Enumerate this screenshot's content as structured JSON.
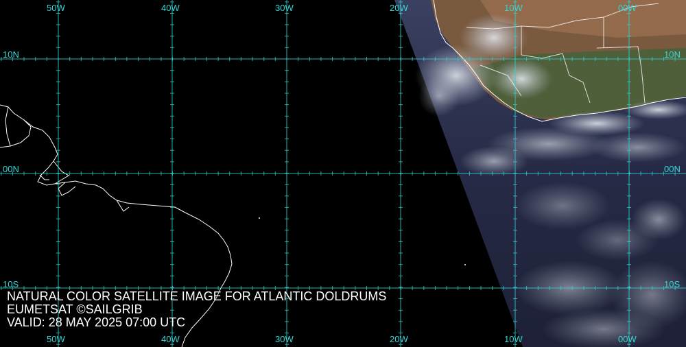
{
  "map": {
    "lon_labels": [
      "50W",
      "40W",
      "30W",
      "20W",
      "10W",
      "00W"
    ],
    "lat_labels": [
      "10N",
      "00N",
      "10S"
    ]
  },
  "caption": {
    "line1": "NATURAL COLOR SATELLITE IMAGE FOR ATLANTIC DOLDRUMS",
    "line2": "EUMETSAT ©SAILGRIB",
    "line3": "VALID:  28 MAY 2025 07:00 UTC"
  },
  "colors": {
    "grid": "#2fd0d0",
    "ocean_dark": "#000000",
    "ocean_imagery": "#2b3150",
    "land_africa": "#7a5a3f",
    "vegetation": "#3f5a35",
    "coast": "#ffffff",
    "caption_text": "#ffffff"
  }
}
